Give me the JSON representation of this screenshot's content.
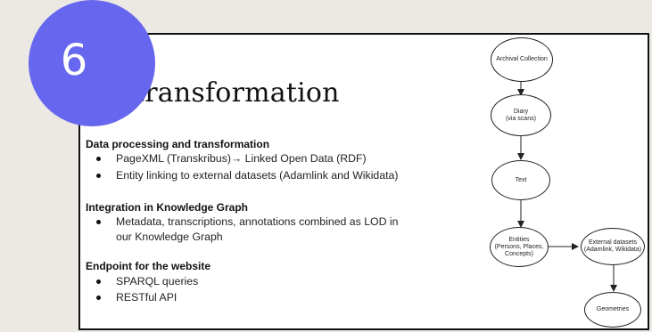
{
  "slide_number": "6",
  "title": "transformation",
  "sections": [
    {
      "heading": "Data processing and transformation",
      "bullets": [
        "PageXML (Transkribus)→ Linked Open Data (RDF)",
        "Entity linking to external datasets (Adamlink and Wikidata)"
      ]
    },
    {
      "heading": "Integration in Knowledge Graph",
      "bullets": [
        "Metadata, transcriptions, annotations combined as LOD in",
        "our Knowledge Graph"
      ]
    },
    {
      "heading": "Endpoint for the website",
      "bullets": [
        "SPARQL queries",
        "RESTful API"
      ]
    }
  ],
  "diagram": {
    "nodes": {
      "archival": "Archival Collection",
      "diary_1": "Diary",
      "diary_2": "(via scans)",
      "text": "Text",
      "entities_1": "Entities",
      "entities_2": "(Persons, Places,",
      "entities_3": "Concepts)",
      "external_1": "External datasets",
      "external_2": "(Adamlink, Wikidata)",
      "geometries": "Geometries"
    }
  },
  "colors": {
    "badge": "#6666ee",
    "background": "#ece8e3",
    "slide": "#ffffff"
  }
}
